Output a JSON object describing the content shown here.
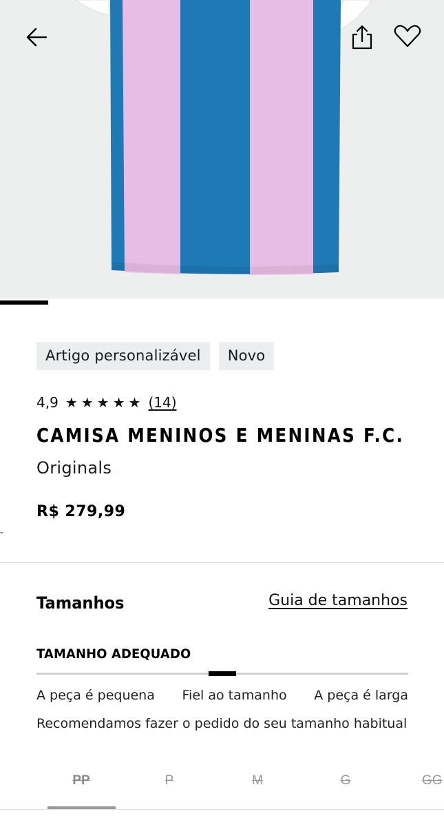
{
  "hero": {
    "image_alt": "Camisa com listras verticais azuis e rosas",
    "colors": {
      "background": "#edefef",
      "stripe_blue": "#1e79b5",
      "stripe_pink": "#e8bde5"
    },
    "icons": {
      "back": "arrow-left-icon",
      "share": "share-icon",
      "favorite": "heart-icon"
    }
  },
  "product": {
    "badges": [
      "Artigo personalizável",
      "Novo"
    ],
    "rating": {
      "score": "4,9",
      "stars": "★★★★★",
      "count": "(14)"
    },
    "title": "CAMISA MENINOS E MENINAS F.C.",
    "brand": "Originals",
    "price": "R$ 279,99",
    "stray_mark": "-"
  },
  "sizes": {
    "title": "Tamanhos",
    "guide_link": "Guia de tamanhos",
    "fit": {
      "title": "TAMANHO ADEQUADO",
      "labels": [
        "A peça é pequena",
        "Fiel ao tamanho",
        "A peça é larga"
      ],
      "note": "Recomendamos fazer o pedido do seu tamanho habitual",
      "position": 0.5
    },
    "options": [
      "PP",
      "P",
      "M",
      "G",
      "GG"
    ]
  }
}
